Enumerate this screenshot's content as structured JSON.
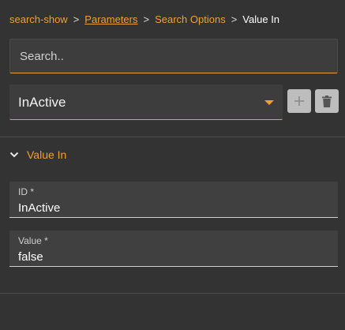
{
  "breadcrumb": {
    "root": "search-show",
    "separator": ">",
    "parameters": "Parameters",
    "search_options": "Search Options",
    "current": "Value In"
  },
  "search": {
    "placeholder": "Search.."
  },
  "selector": {
    "selected": "InActive",
    "caret_icon": "caret-down-icon"
  },
  "actions": {
    "add_icon": "plus-icon",
    "delete_icon": "trash-icon"
  },
  "section": {
    "title": "Value In",
    "expanded": true
  },
  "fields": {
    "id": {
      "label": "ID *",
      "value": "InActive"
    },
    "value": {
      "label": "Value *",
      "value": "false"
    }
  },
  "colors": {
    "accent": "#f0a030",
    "background": "#333333",
    "field_background": "#404040",
    "button_background": "#bdbdbd"
  }
}
